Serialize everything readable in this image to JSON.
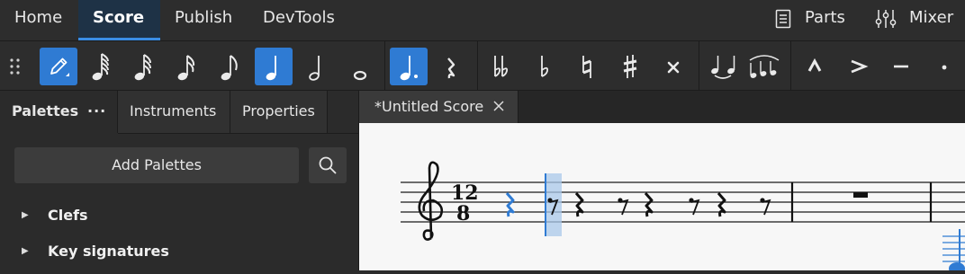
{
  "menu": {
    "tabs": [
      {
        "label": "Home",
        "active": false
      },
      {
        "label": "Score",
        "active": true
      },
      {
        "label": "Publish",
        "active": false
      },
      {
        "label": "DevTools",
        "active": false
      }
    ],
    "right": {
      "parts": "Parts",
      "mixer": "Mixer"
    }
  },
  "toolbar": {
    "note_input": {
      "icon": "pencil-icon",
      "active": true
    },
    "durations": [
      "64th-note",
      "32nd-note",
      "16th-note",
      "eighth-note",
      "quarter-note",
      "half-note",
      "whole-note"
    ],
    "active_duration": "quarter-note",
    "augmentation_dot": {
      "active": true
    },
    "rest": "rest",
    "accidentals": [
      "double-flat",
      "flat",
      "natural",
      "sharp",
      "double-sharp"
    ],
    "ties": [
      "tie",
      "slur"
    ],
    "articulations": [
      "marcato",
      "accent",
      "tenuto",
      "staccato"
    ]
  },
  "palettes_panel": {
    "tabs": [
      {
        "label": "Palettes",
        "active": true
      },
      {
        "label": "Instruments",
        "active": false
      },
      {
        "label": "Properties",
        "active": false
      }
    ],
    "more_label": "···",
    "add_button": "Add Palettes",
    "items": [
      "Clefs",
      "Key signatures"
    ]
  },
  "document": {
    "tab_title": "*Untitled Score"
  },
  "score": {
    "time_signature": {
      "numerator": "12",
      "denominator": "8"
    },
    "accent": "#2f7bd3"
  }
}
